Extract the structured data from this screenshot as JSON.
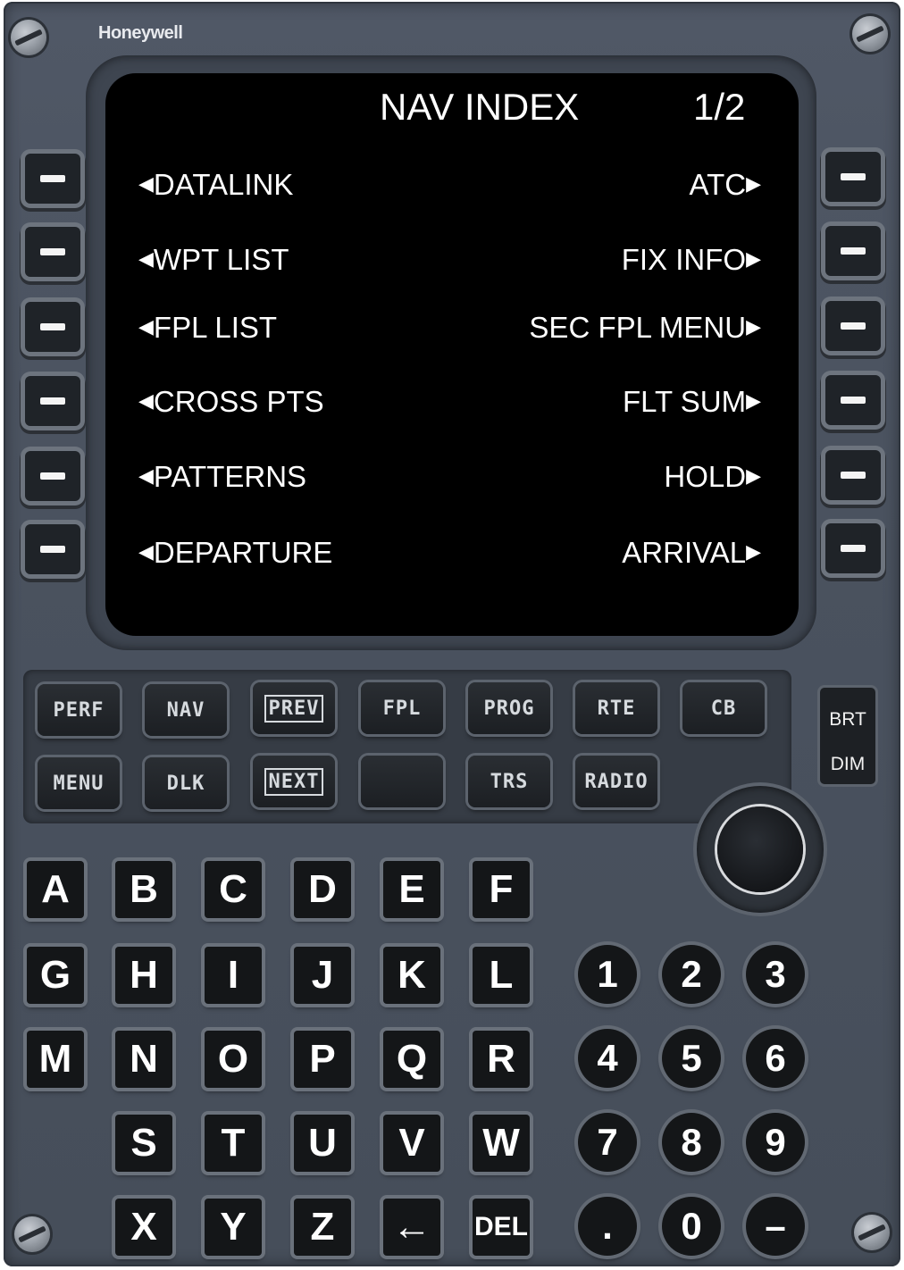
{
  "brand": "Honeywell",
  "screen": {
    "title": "NAV INDEX",
    "page": "1/2",
    "left_items": [
      "DATALINK",
      "WPT LIST",
      "FPL LIST",
      "CROSS PTS",
      "PATTERNS",
      "DEPARTURE"
    ],
    "right_items": [
      "ATC",
      "FIX INFO",
      "SEC FPL MENU",
      "FLT SUM",
      "HOLD",
      "ARRIVAL"
    ],
    "left_arrow": "◀",
    "right_arrow": "▶"
  },
  "function_keys": {
    "row1": [
      "PERF",
      "NAV",
      "PREV",
      "FPL",
      "PROG",
      "RTE",
      "CB"
    ],
    "row2": [
      "MENU",
      "DLK",
      "NEXT",
      "",
      "TRS",
      "RADIO"
    ]
  },
  "brightness": {
    "bright_label": "BRT",
    "dim_label": "DIM"
  },
  "alpha_keys": {
    "row1": [
      "A",
      "B",
      "C",
      "D",
      "E",
      "F"
    ],
    "row2": [
      "G",
      "H",
      "I",
      "J",
      "K",
      "L"
    ],
    "row3": [
      "M",
      "N",
      "O",
      "P",
      "Q",
      "R"
    ],
    "row4": [
      "S",
      "T",
      "U",
      "V",
      "W"
    ],
    "row5": [
      "X",
      "Y",
      "Z",
      "←",
      "DEL"
    ]
  },
  "numeric_keys": {
    "row1": [
      "1",
      "2",
      "3"
    ],
    "row2": [
      "4",
      "5",
      "6"
    ],
    "row3": [
      "7",
      "8",
      "9"
    ],
    "row4": [
      ".",
      "0",
      "–"
    ]
  }
}
